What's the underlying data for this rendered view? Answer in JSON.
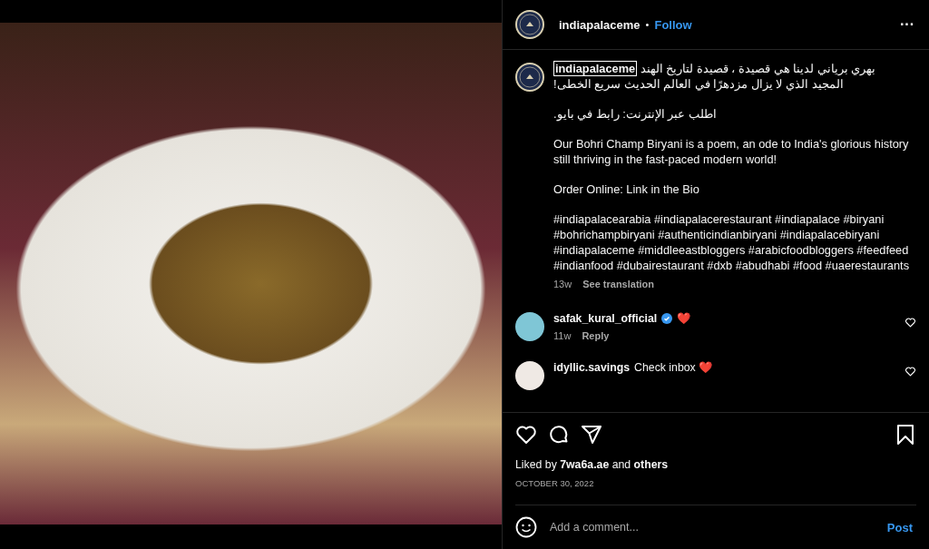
{
  "post": {
    "username": "indiapalaceme",
    "separator": "•",
    "follow": "Follow",
    "more": "···"
  },
  "caption": {
    "username": "indiapalaceme",
    "arabic_lines": [
      "بهري برياني لدينا هي قصيدة ، قصيدة لتاريخ الهند",
      "المجيد الذي لا يزال مزدهرًا في العالم الحديث سريع الخطى!"
    ],
    "arabic_order": "اطلب عبر الإنترنت: رابط في بايو.",
    "paragraphs": [
      "Our Bohri Champ Biryani is a poem, an ode to India's glorious history still thriving in the fast-paced modern world!",
      "Order Online: Link in the Bio",
      "#indiapalacearabia #indiapalacerestaurant #indiapalace #biryani #bohrichampbiryani #authenticindianbiryani #indiapalacebiryani #indiapalaceme #middleeastbloggers #arabicfoodbloggers #feedfeed #indianfood #dubairestaurant #dxb #abudhabi #food #uaerestaurants"
    ],
    "time": "13w",
    "translate": "See translation"
  },
  "comments": [
    {
      "username": "safak_kural_official",
      "verified": true,
      "text": "❤️",
      "time": "11w",
      "reply": "Reply"
    },
    {
      "username": "idyllic.savings",
      "verified": false,
      "text": "Check inbox ❤️"
    }
  ],
  "likes": {
    "prefix": "Liked by",
    "user": "7wa6a.ae",
    "middle": "and",
    "others": "others"
  },
  "date": "OCTOBER 30, 2022",
  "composer": {
    "placeholder": "Add a comment...",
    "post": "Post"
  }
}
